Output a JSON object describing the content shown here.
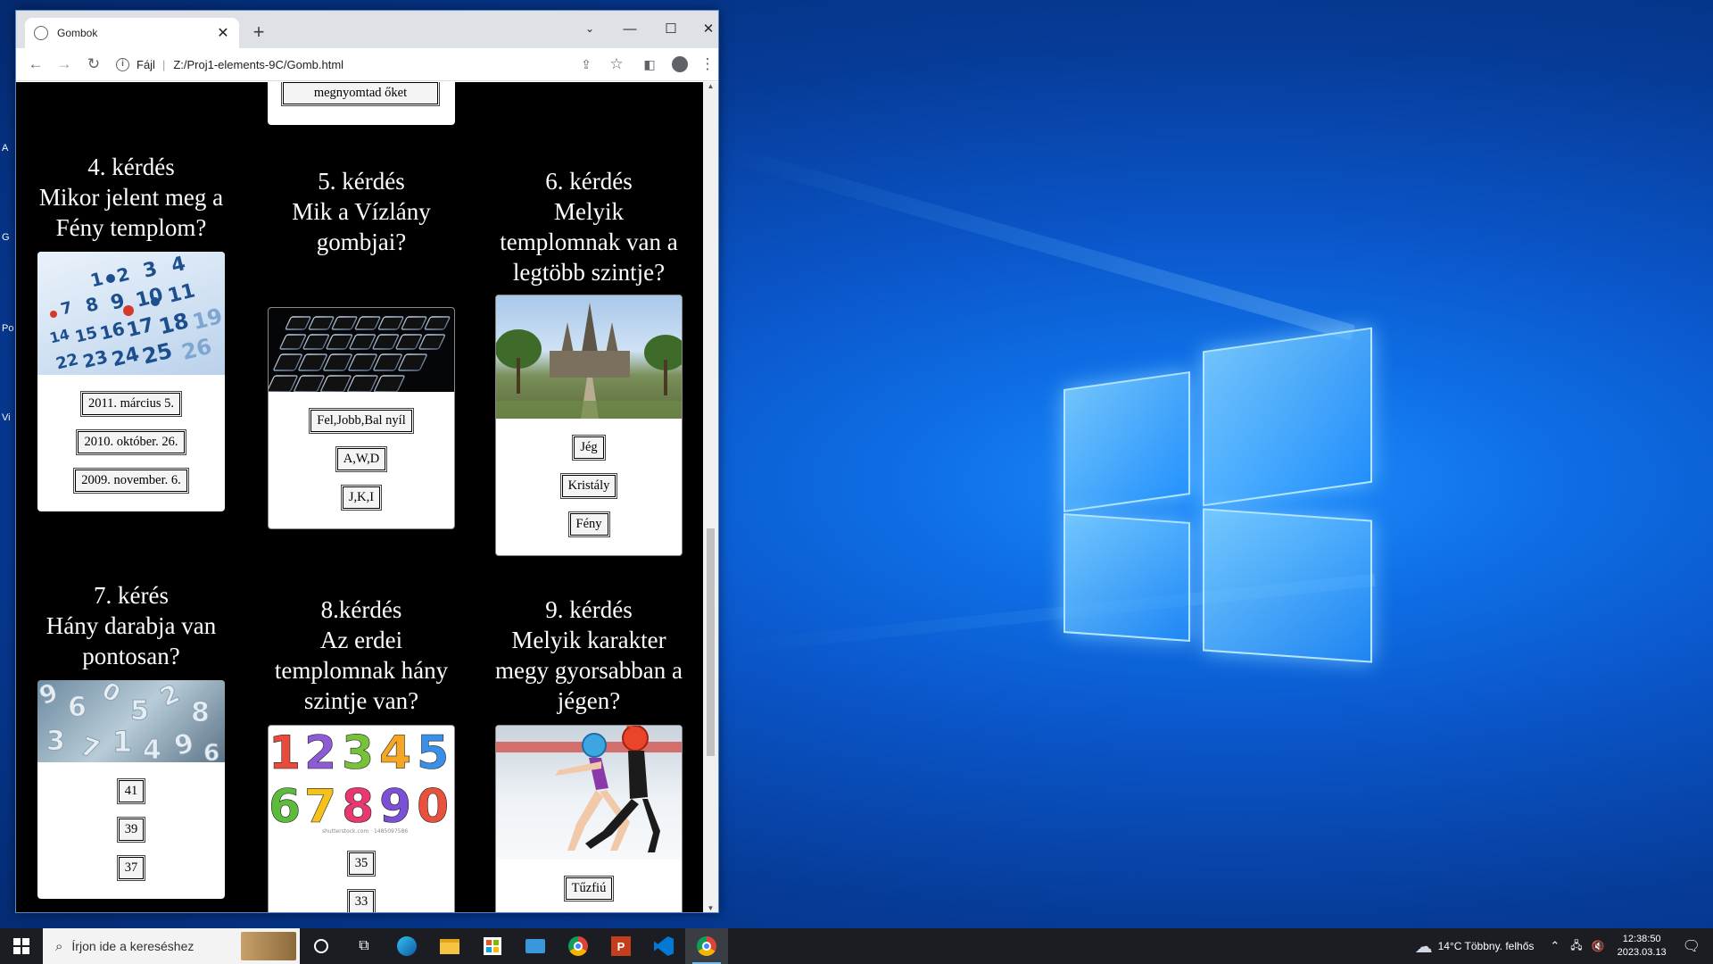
{
  "browser": {
    "tab_title": "Gombok",
    "new_tab_symbol": "+",
    "address_prefix": "Fájl",
    "url": "Z:/Proj1-elements-9C/Gomb.html"
  },
  "page": {
    "partial_button": "megnyomtad őket",
    "questions": [
      {
        "title": "4. kérdés\nMikor jelent meg a Fény templom?",
        "image": "calendar",
        "answers": [
          "2011. március 5.",
          "2010. október. 26.",
          "2009. november. 6."
        ]
      },
      {
        "title": "5. kérdés\nMik a Vízlány gombjai?",
        "image": "keyboard",
        "answers": [
          "Fel,Jobb,Bal nyíl",
          "A,W,D",
          "J,K,I"
        ]
      },
      {
        "title": "6. kérdés\nMelyik templomnak van a legtöbb szintje?",
        "image": "temple",
        "answers": [
          "Jég",
          "Kristály",
          "Fény"
        ]
      },
      {
        "title": "7. kérés\nHány darabja van pontosan?",
        "image": "numbers-pile",
        "answers": [
          "41",
          "39",
          "37"
        ]
      },
      {
        "title": "8.kérdés\nAz erdei templomnak hány szintje van?",
        "image": "colorful-digits",
        "answers": [
          "35",
          "33"
        ]
      },
      {
        "title": "9. kérdés\nMelyik karakter megy gyorsabban a jégen?",
        "image": "ice-skaters",
        "answers": [
          "Tűzfiú"
        ]
      }
    ]
  },
  "taskbar": {
    "search_placeholder": "Írjon ide a kereséshez",
    "weather": "14°C  Többny. felhős",
    "time": "12:38:50",
    "date": "2023.03.13"
  }
}
